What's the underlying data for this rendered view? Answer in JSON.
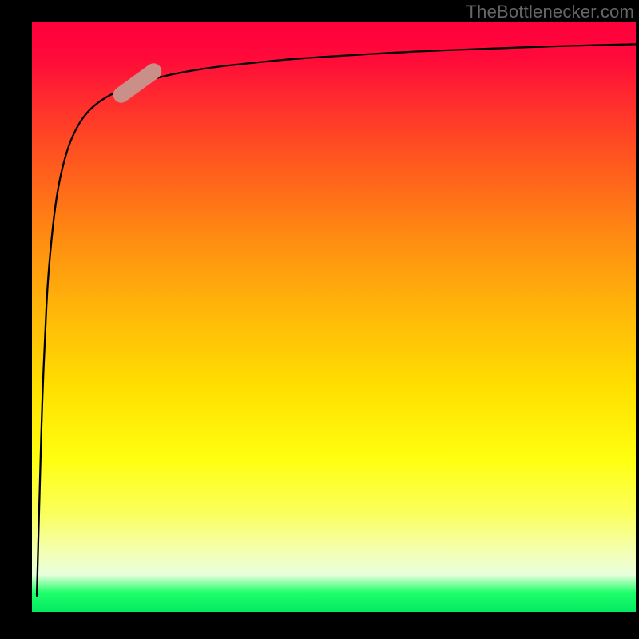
{
  "watermark": "TheBottlenecker.com",
  "colors": {
    "top": "#ff003d",
    "bottom": "#00e860",
    "curve": "#000000",
    "marker": "#c98f88",
    "axis": "#000000",
    "background": "#000000"
  },
  "chart_data": {
    "type": "line",
    "title": "",
    "xlabel": "",
    "ylabel": "",
    "xlim": [
      0,
      100
    ],
    "ylim": [
      0,
      100
    ],
    "series": [
      {
        "name": "bottleneck-curve",
        "x": [
          0.8,
          1.0,
          1.3,
          1.7,
          2.2,
          2.6,
          3.2,
          3.8,
          4.5,
          5.3,
          6.2,
          7.3,
          8.5,
          10,
          12,
          14.5,
          17.5,
          21,
          25,
          30,
          36,
          43,
          52,
          62,
          74,
          88,
          100
        ],
        "y": [
          3,
          10,
          22,
          36,
          48,
          56,
          63,
          68.5,
          73,
          76.5,
          79.5,
          82,
          84,
          85.7,
          87.2,
          88.5,
          89.7,
          90.7,
          91.6,
          92.4,
          93.1,
          93.8,
          94.4,
          95,
          95.5,
          96,
          96.3
        ]
      }
    ],
    "marker": {
      "x": 17.5,
      "y": 89.7,
      "angle_deg": -36
    },
    "annotations": []
  }
}
